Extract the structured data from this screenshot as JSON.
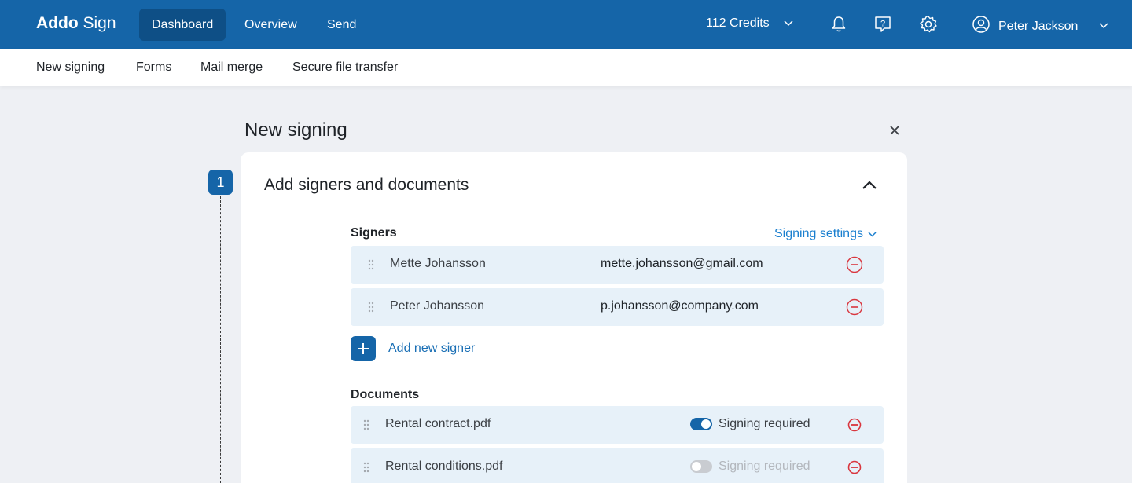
{
  "topbar": {
    "logo_bold": "Addo",
    "logo_light": "Sign",
    "nav": [
      {
        "label": "Dashboard",
        "active": true
      },
      {
        "label": "Overview",
        "active": false
      },
      {
        "label": "Send",
        "active": false
      }
    ],
    "credits": "112  Credits",
    "user_name": "Peter Jackson",
    "icons": [
      "bell-icon",
      "help-icon",
      "gear-icon",
      "user-icon"
    ]
  },
  "subnav": {
    "items": [
      {
        "label": "New signing",
        "active": true
      },
      {
        "label": "Forms",
        "active": false
      },
      {
        "label": "Mail merge",
        "active": false
      },
      {
        "label": "Secure file transfer",
        "active": false
      }
    ]
  },
  "page": {
    "title": "New signing",
    "step_number": "1"
  },
  "card": {
    "title": "Add signers and documents",
    "signers_label": "Signers",
    "signing_settings": "Signing settings",
    "signers": [
      {
        "name": "Mette Johansson",
        "email": "mette.johansson@gmail.com"
      },
      {
        "name": "Peter Johansson",
        "email": "p.johansson@company.com"
      }
    ],
    "add_signer": "Add new signer",
    "documents_label": "Documents",
    "documents": [
      {
        "name": "Rental contract.pdf",
        "signing_required": true,
        "label": "Signing required"
      },
      {
        "name": "Rental conditions.pdf",
        "signing_required": false,
        "label": "Signing required"
      }
    ]
  },
  "colors": {
    "brand": "#1565a8",
    "brand_dark": "#0e4f86",
    "row_bg": "#e7f1f9",
    "remove_red": "#d9363e",
    "link": "#1a7fcf"
  }
}
